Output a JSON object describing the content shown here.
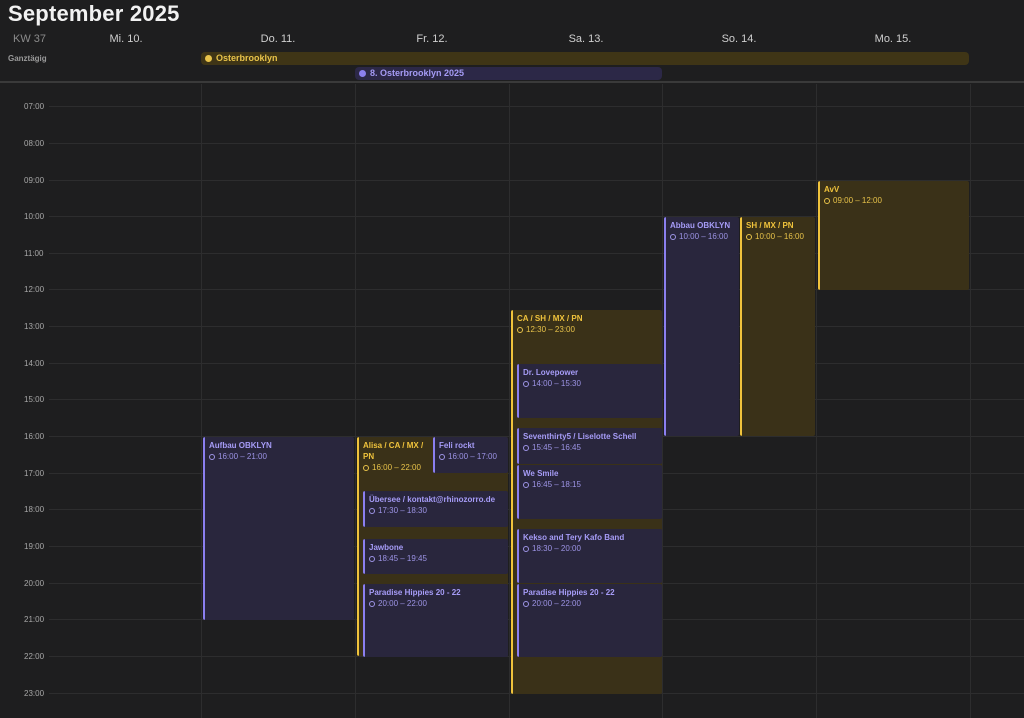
{
  "header": {
    "title": "September 2025",
    "week": "KW 37"
  },
  "days": [
    "Mi. 10.",
    "Do. 11.",
    "Fr. 12.",
    "Sa. 13.",
    "So. 14.",
    "Mo. 15."
  ],
  "allday": {
    "label": "Ganztägig",
    "events": [
      {
        "title": "Osterbrooklyn",
        "color": "#e8c34a"
      },
      {
        "title": "8. Osterbrooklyn 2025",
        "color": "#8c80f0"
      }
    ]
  },
  "times": [
    "07:00",
    "08:00",
    "09:00",
    "10:00",
    "11:00",
    "12:00",
    "13:00",
    "14:00",
    "15:00",
    "16:00",
    "17:00",
    "18:00",
    "19:00",
    "20:00",
    "21:00",
    "22:00",
    "23:00"
  ],
  "events": [
    {
      "title": "Aufbau OBKLYN",
      "time": "16:00 – 21:00"
    },
    {
      "title": "Alisa / CA / MX / PN",
      "time": "16:00 – 22:00"
    },
    {
      "title": "Feli rockt",
      "time": "16:00 – 17:00"
    },
    {
      "title": "Übersee / kontakt@rhinozorro.de",
      "time": "17:30 – 18:30"
    },
    {
      "title": "Jawbone",
      "time": "18:45 – 19:45"
    },
    {
      "title": "Paradise Hippies 20 - 22",
      "time": "20:00 – 22:00"
    },
    {
      "title": "CA / SH / MX / PN",
      "time": "12:30 – 23:00"
    },
    {
      "title": "Dr. Lovepower",
      "time": "14:00 – 15:30"
    },
    {
      "title": "Seventhirty5 / Liselotte Schell",
      "time": "15:45 – 16:45"
    },
    {
      "title": "We Smile",
      "time": "16:45 – 18:15"
    },
    {
      "title": "Kekso and Tery Kafo Band",
      "time": "18:30 – 20:00"
    },
    {
      "title": "Paradise Hippies 20 - 22",
      "time": "20:00 – 22:00"
    },
    {
      "title": "Abbau OBKLYN",
      "time": "10:00 – 16:00"
    },
    {
      "title": "SH / MX / PN",
      "time": "10:00 – 16:00"
    },
    {
      "title": "AvV",
      "time": "09:00 – 12:00"
    }
  ],
  "colors": {
    "background": "#1e1e1f",
    "yellow": "#f0c33c",
    "purple": "#8b7ff0"
  }
}
